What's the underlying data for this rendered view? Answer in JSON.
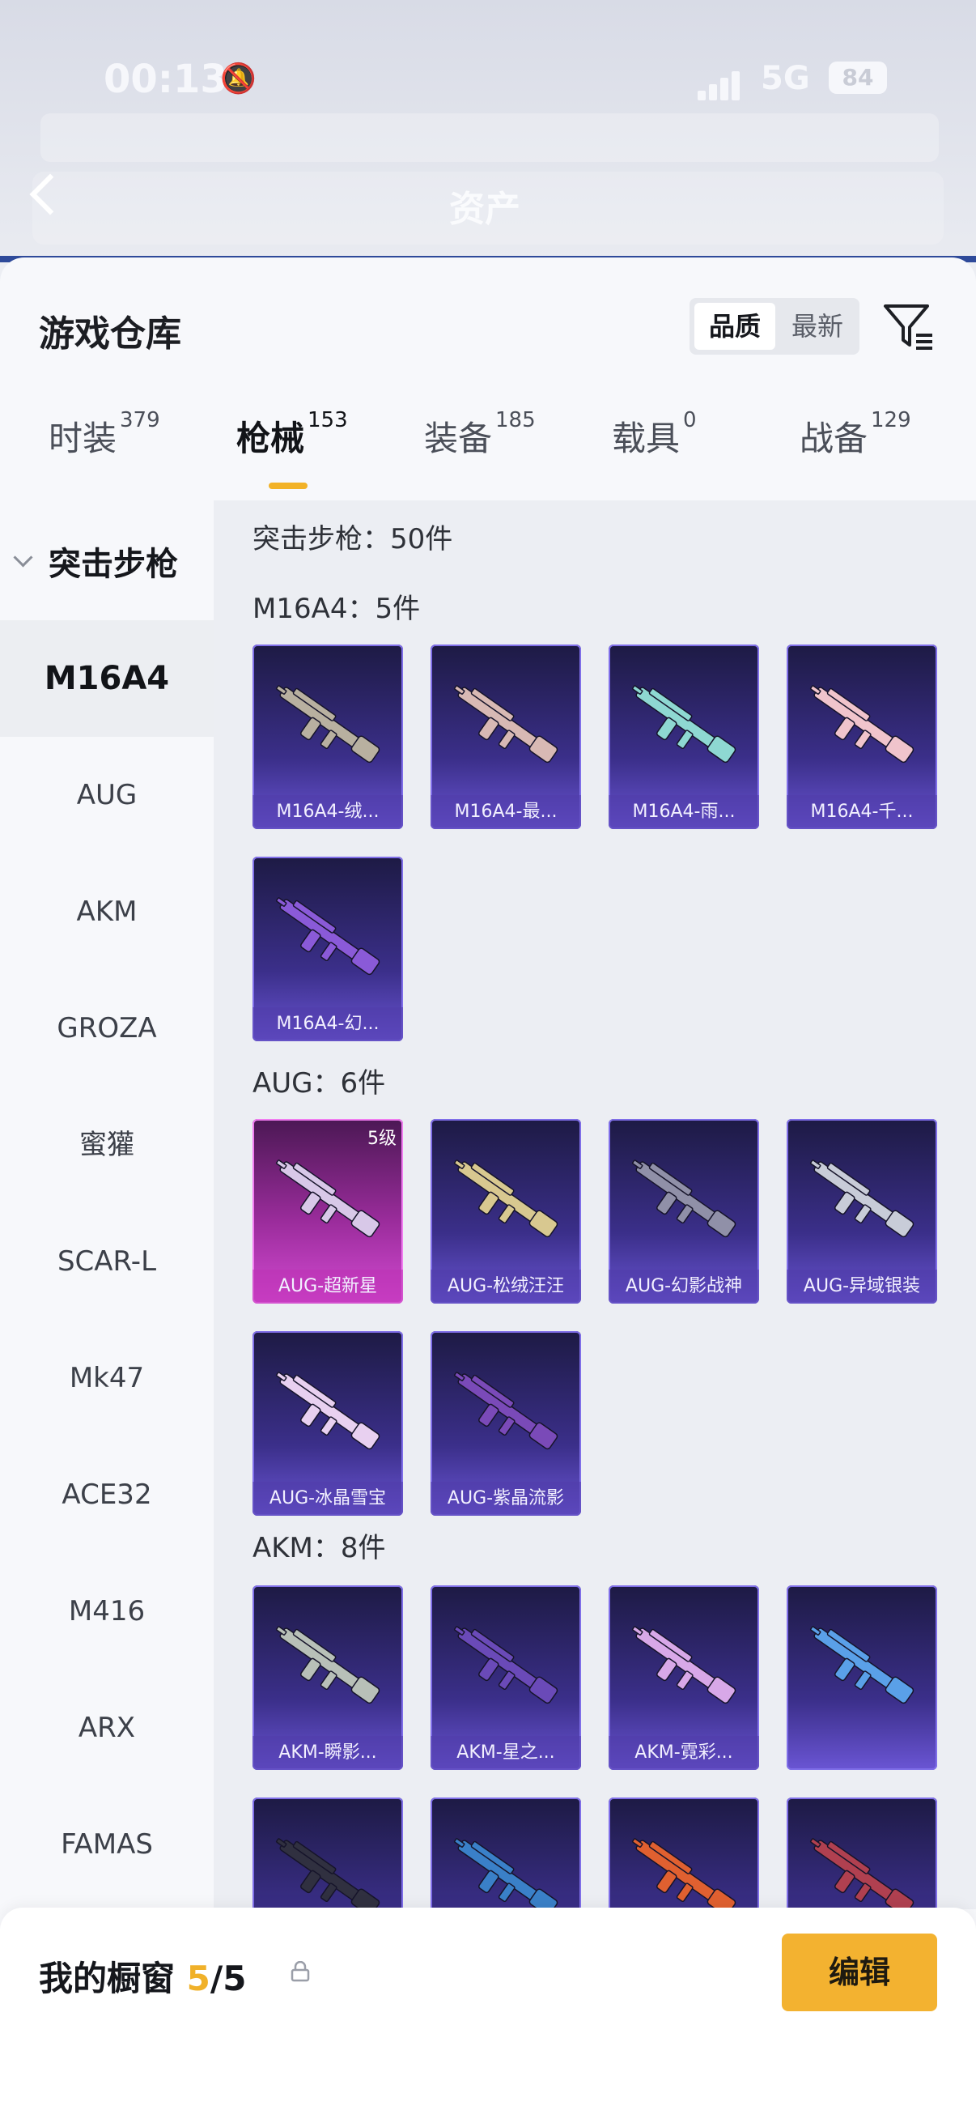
{
  "status_bar": {
    "time": "00:13",
    "network": "5G",
    "battery": "84"
  },
  "background_page": {
    "title": "资产"
  },
  "sheet": {
    "title": "游戏仓库",
    "sort": {
      "options": [
        "品质",
        "最新"
      ],
      "selected": "品质"
    },
    "tabs": [
      {
        "label": "时装",
        "count": "379"
      },
      {
        "label": "枪械",
        "count": "153",
        "active": true
      },
      {
        "label": "装备",
        "count": "185"
      },
      {
        "label": "载具",
        "count": "0"
      },
      {
        "label": "战备",
        "count": "129"
      }
    ]
  },
  "sidebar": {
    "group": "突击步枪",
    "items": [
      "M16A4",
      "AUG",
      "AKM",
      "GROZA",
      "蜜獾",
      "SCAR-L",
      "Mk47",
      "ACE32",
      "M416",
      "ARX",
      "FAMAS"
    ],
    "active": "M16A4"
  },
  "main": {
    "summary": "突击步枪：50件",
    "groups": [
      {
        "heading": "M16A4：5件",
        "cards": [
          {
            "label": "M16A4-绒...",
            "tint": "#b8b0a0"
          },
          {
            "label": "M16A4-最...",
            "tint": "#d8b9b4"
          },
          {
            "label": "M16A4-雨...",
            "tint": "#8ed8d2"
          },
          {
            "label": "M16A4-千...",
            "tint": "#f0c4cc"
          },
          {
            "label": "M16A4-幻...",
            "tint": "#8a5ad8"
          }
        ]
      },
      {
        "heading": "AUG：6件",
        "cards": [
          {
            "label": "AUG-超新星",
            "tint": "#d8c8e8",
            "level": "5级",
            "rare": true
          },
          {
            "label": "AUG-松绒汪汪",
            "tint": "#d8c890"
          },
          {
            "label": "AUG-幻影战神",
            "tint": "#9090a8"
          },
          {
            "label": "AUG-异域银装",
            "tint": "#c8ccd8"
          },
          {
            "label": "AUG-冰晶雪宝",
            "tint": "#e8d0f0"
          },
          {
            "label": "AUG-紫晶流影",
            "tint": "#7a4ab8"
          }
        ]
      },
      {
        "heading": "AKM：8件",
        "cards": [
          {
            "label": "AKM-瞬影...",
            "tint": "#b8c0b8"
          },
          {
            "label": "AKM-星之...",
            "tint": "#6a4ab8"
          },
          {
            "label": "AKM-霓彩...",
            "tint": "#d8a8e8"
          },
          {
            "label": "",
            "tint": "#5aa0e8"
          },
          {
            "label": "",
            "tint": "#303040"
          },
          {
            "label": "",
            "tint": "#3a80c8"
          },
          {
            "label": "",
            "tint": "#e06030"
          },
          {
            "label": "",
            "tint": "#b04050"
          }
        ]
      }
    ]
  },
  "bottom_bar": {
    "title": "我的橱窗",
    "used": "5",
    "separator": "/",
    "total": "5",
    "edit_label": "编辑"
  },
  "colors": {
    "accent": "#f3b230",
    "card_base": "#3b2f8a",
    "card_rare": "#9a2c9b"
  }
}
